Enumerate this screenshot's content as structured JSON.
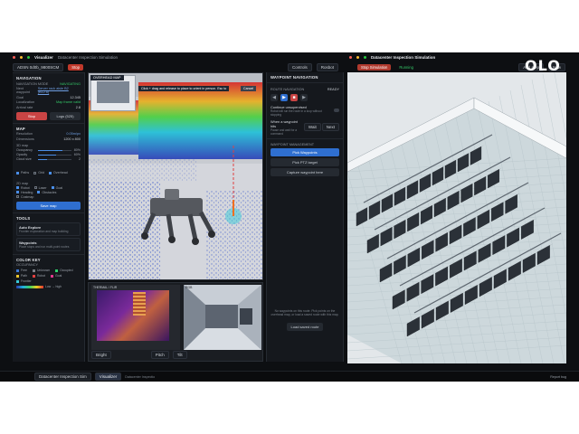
{
  "window_tabs": {
    "left": "Visualizer",
    "left_sub": "Datacenter Inspection Simulation",
    "right": "Datacenter Inspection Simulation"
  },
  "toolbar": {
    "device": "ADSN 0d0b_9800SCM",
    "stop": "Stop",
    "controls": "Controls",
    "rosbot": "Rosbot",
    "stop_simulation": "Stop Simulation",
    "running": "Running",
    "add_step": "Add step",
    "new": "New"
  },
  "navigation": {
    "title": "NAVIGATION",
    "subtitle": "NAVIGATION MODE",
    "status": "NAVIGATING",
    "rows": [
      {
        "label": "Next waypoint",
        "value": "Server rack aisle B2 (B12.6)"
      },
      {
        "label": "Goal",
        "value": "12.345"
      },
      {
        "label": "Localization",
        "value": "Map frame valid"
      },
      {
        "label": "Arrival rate",
        "value": "2.8"
      }
    ],
    "stop_btn": "Stop",
    "logs_btn": "Logs (525)"
  },
  "map": {
    "title": "MAP",
    "resolution_label": "Resolution",
    "resolution_value": "0.05m/px",
    "dimensions_label": "Dimensions",
    "dimensions_value": "1200 x 800",
    "render_label": "3D map",
    "sliders": [
      {
        "label": "Occupancy",
        "value": "80%",
        "fill": 0.8
      },
      {
        "label": "Opacity",
        "value": "60%",
        "fill": 0.6
      },
      {
        "label": "Cloud size",
        "value": "2",
        "fill": 0.3
      }
    ],
    "checks": [
      {
        "label": "Paths",
        "on": true
      },
      {
        "label": "Grid",
        "on": false
      },
      {
        "label": "Overhead",
        "on": true
      }
    ],
    "map2_label": "2D map",
    "checks2": [
      {
        "label": "Robot",
        "on": true
      },
      {
        "label": "Laser",
        "on": false
      },
      {
        "label": "Goal",
        "on": true
      },
      {
        "label": "Heading",
        "on": true
      },
      {
        "label": "Obstacles",
        "on": true
      },
      {
        "label": "Costmap",
        "on": false
      }
    ],
    "save_btn": "Save map"
  },
  "tools": {
    "title": "TOOLS",
    "items": [
      {
        "title": "Auto Explore",
        "desc": "Frontier exploration and map building"
      },
      {
        "title": "Waypoints",
        "desc": "Place stops and run multi-point routes"
      }
    ]
  },
  "color_key": {
    "title": "COLOR KEY",
    "sub": "OCCUPANCY",
    "items": [
      {
        "label": "Free",
        "color": "#3a78d8"
      },
      {
        "label": "Unknown",
        "color": "#7a7f86"
      },
      {
        "label": "Occupied",
        "color": "#2ed06a"
      },
      {
        "label": "Path",
        "color": "#e9c52c"
      },
      {
        "label": "Robot",
        "color": "#e04040"
      },
      {
        "label": "Goal",
        "color": "#e03a8c"
      },
      {
        "label": "Frontier",
        "color": "#38c9d8"
      }
    ],
    "gradient_label": "Low → high"
  },
  "overhead": {
    "title": "OVERHEAD MAP",
    "hint": "Click + drag and release to place to orient in person. Esc to",
    "cancel": "Cancel",
    "thermal_label": "THERMAL / FLIR",
    "rgb_label": "RGB",
    "bottom_left": "Bright",
    "bottom_mid": "Pitch",
    "bottom_right": "Tilt"
  },
  "waypoint": {
    "title": "WAYPOINT NAVIGATION",
    "route_label": "ROUTE NAVIGATION",
    "route_status": "READY",
    "continue_title": "Continue unsupervised",
    "continue_desc": "Robot will run the route in a loop without stopping",
    "reached_title": "When a waypoint hits",
    "reached_desc": "Pause and wait for a command",
    "wait_btn": "Wait",
    "next_btn": "Next",
    "mgmt_label": "WAYPOINT MANAGEMENT",
    "pick_btn": "Pick Waypoints",
    "pick_ptz": "Pick PTZ target",
    "capture": "Capture waypoint here",
    "empty_note": "No waypoints on this route. Pick points on the overhead map, or load a saved route with this map.",
    "load_btn": "Load saved route"
  },
  "watermark": "OLO",
  "taskbar": {
    "item1": "Datacenter Inspection Sim",
    "item2": "Visualizer",
    "item2_sub": "Datacenter Inspectio",
    "right": "Report bug"
  }
}
